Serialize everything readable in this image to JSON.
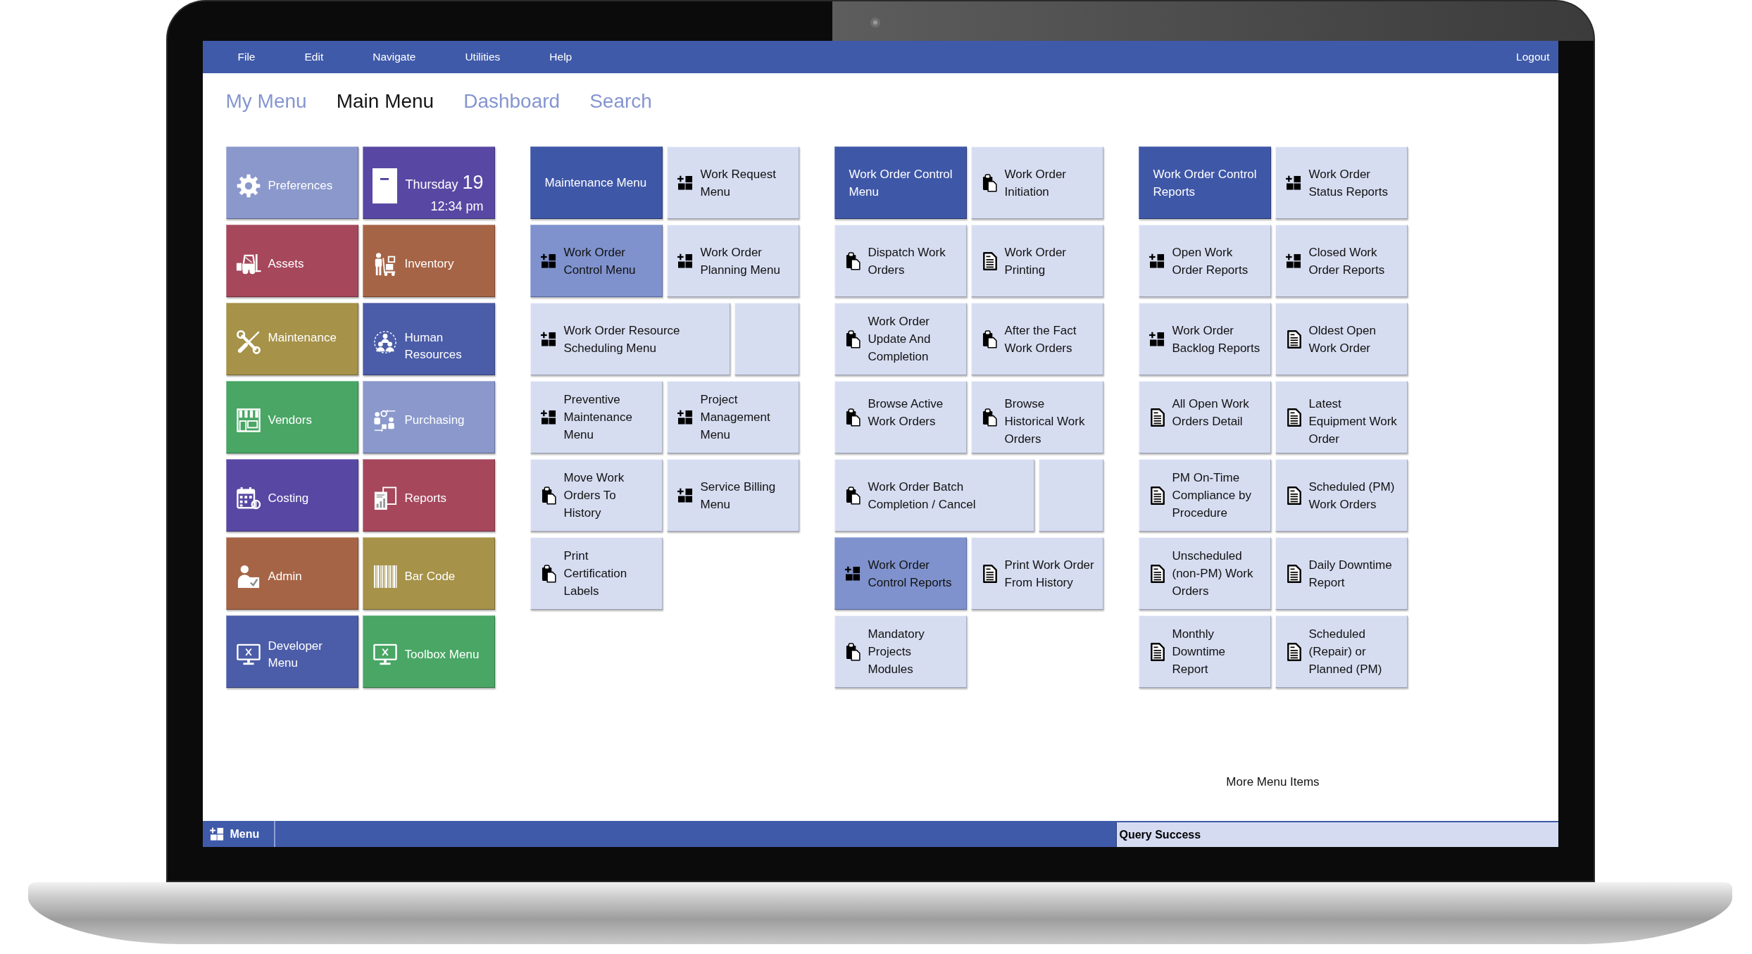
{
  "menu_bar": {
    "items": [
      "File",
      "Edit",
      "Navigate",
      "Utilities",
      "Help"
    ],
    "logout": "Logout"
  },
  "tabs": [
    {
      "label": "My Menu",
      "selected": false
    },
    {
      "label": "Main Menu",
      "selected": true
    },
    {
      "label": "Dashboard",
      "selected": false
    },
    {
      "label": "Search",
      "selected": false
    }
  ],
  "modules": [
    {
      "kind": "module",
      "label": "Preferences",
      "color": "#8a98cc"
    },
    {
      "kind": "calendar",
      "weekday": "Thursday",
      "day": "19",
      "time": "12:34 pm",
      "color": "#5848a4"
    },
    {
      "kind": "module",
      "label": "Assets",
      "color": "#a6475c"
    },
    {
      "kind": "module",
      "label": "Inventory",
      "color": "#a66446"
    },
    {
      "kind": "module",
      "label": "Maintenance",
      "color": "#a69248"
    },
    {
      "kind": "module",
      "label": "Human Resources",
      "color": "#4b5ca8"
    },
    {
      "kind": "module",
      "label": "Vendors",
      "color": "#49a665"
    },
    {
      "kind": "module",
      "label": "Purchasing",
      "color": "#8a98cc"
    },
    {
      "kind": "module",
      "label": "Costing",
      "color": "#5848a4"
    },
    {
      "kind": "module",
      "label": "Reports",
      "color": "#a6475c"
    },
    {
      "kind": "module",
      "label": "Admin",
      "color": "#a66446"
    },
    {
      "kind": "module",
      "label": "Bar Code",
      "color": "#a69248"
    },
    {
      "kind": "module",
      "label": "Developer Menu",
      "color": "#4b5ca8"
    },
    {
      "kind": "module",
      "label": "Toolbox Menu",
      "color": "#49a665"
    }
  ],
  "menu_columns": [
    {
      "title": "Maintenance Menu",
      "items": [
        {
          "kind": "submenu",
          "label": "Work Request Menu",
          "selected": false
        },
        {
          "kind": "submenu",
          "label": "Work Order Control Menu",
          "selected": true
        },
        {
          "kind": "submenu",
          "label": "Work Order Planning Menu",
          "selected": false
        },
        {
          "kind": "submenu",
          "label": "Work Order Resource Scheduling Menu",
          "selected": false
        },
        {
          "kind": "blank"
        },
        {
          "kind": "submenu",
          "label": "Preventive Maintenance Menu",
          "selected": false
        },
        {
          "kind": "submenu",
          "label": "Project Management Menu",
          "selected": false
        },
        {
          "kind": "program",
          "label": "Move Work Orders To History",
          "selected": false
        },
        {
          "kind": "submenu",
          "label": "Service Billing Menu",
          "selected": false
        },
        {
          "kind": "program",
          "label": "Print Certification Labels",
          "selected": false
        }
      ]
    },
    {
      "title": "Work Order Control Menu",
      "items": [
        {
          "kind": "program",
          "label": "Work Order Initiation",
          "selected": false
        },
        {
          "kind": "program",
          "label": "Dispatch Work Orders",
          "selected": false
        },
        {
          "kind": "report",
          "label": "Work Order Printing",
          "selected": false
        },
        {
          "kind": "program",
          "label": "Work Order Update And Completion",
          "selected": false
        },
        {
          "kind": "program",
          "label": "After the Fact Work Orders",
          "selected": false
        },
        {
          "kind": "program",
          "label": "Browse Active Work Orders",
          "selected": false
        },
        {
          "kind": "program",
          "label": "Browse Historical Work Orders",
          "selected": false
        },
        {
          "kind": "program",
          "label": "Work Order Batch Completion / Cancel",
          "selected": false
        },
        {
          "kind": "blank"
        },
        {
          "kind": "submenu",
          "label": "Work Order Control Reports",
          "selected": true
        },
        {
          "kind": "report",
          "label": "Print Work Order From History",
          "selected": false
        },
        {
          "kind": "program",
          "label": "Mandatory Projects Modules",
          "selected": false
        }
      ]
    },
    {
      "title": "Work Order Control Reports",
      "items": [
        {
          "kind": "submenu",
          "label": "Work Order Status Reports",
          "selected": false
        },
        {
          "kind": "submenu",
          "label": "Open Work Order Reports",
          "selected": false
        },
        {
          "kind": "submenu",
          "label": "Closed Work Order Reports",
          "selected": false
        },
        {
          "kind": "submenu",
          "label": "Work Order Backlog Reports",
          "selected": false
        },
        {
          "kind": "report",
          "label": "Oldest Open Work Order",
          "selected": false
        },
        {
          "kind": "report",
          "label": "All Open Work Orders Detail",
          "selected": false
        },
        {
          "kind": "report",
          "label": "Latest Equipment Work Order",
          "selected": false
        },
        {
          "kind": "report",
          "label": "PM On-Time Compliance by Procedure",
          "selected": false
        },
        {
          "kind": "report",
          "label": "Scheduled (PM) Work Orders",
          "selected": false
        },
        {
          "kind": "report",
          "label": "Unscheduled (non-PM) Work Orders",
          "selected": false
        },
        {
          "kind": "report",
          "label": "Daily Downtime Report",
          "selected": false
        },
        {
          "kind": "report",
          "label": "Monthly Downtime Report",
          "selected": false
        },
        {
          "kind": "report",
          "label": "Scheduled (Repair) or Planned (PM)",
          "selected": false
        }
      ]
    }
  ],
  "more_link": "More Menu Items",
  "bottom_bar": {
    "menu_button": "Menu",
    "status": "Query Success"
  }
}
